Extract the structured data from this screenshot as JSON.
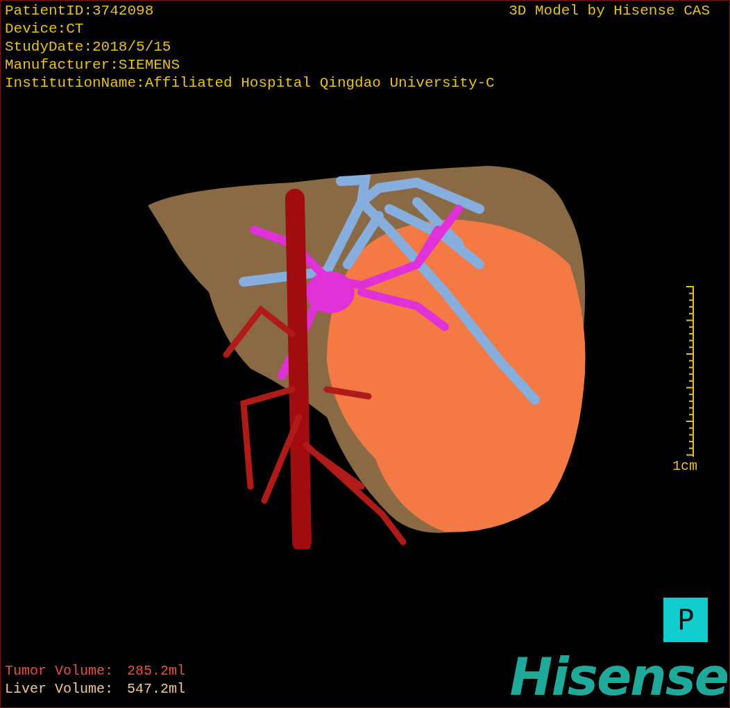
{
  "info_lines": [
    "PatientID:3742098",
    "Device:CT",
    "StudyDate:2018/5/15",
    "Manufacturer:SIEMENS",
    "InstitutionName:Affiliated Hospital Qingdao University-C"
  ],
  "title": "3D Model by Hisense CAS",
  "scale": {
    "label": "1cm"
  },
  "orientation_marker": "P",
  "volumes": [
    {
      "label": "Tumor Volume:",
      "value": "285.2ml",
      "color": "#e8503a"
    },
    {
      "label": "Liver Volume:",
      "value": "547.2ml",
      "color": "#f0c890"
    }
  ],
  "logo": "Hisense"
}
